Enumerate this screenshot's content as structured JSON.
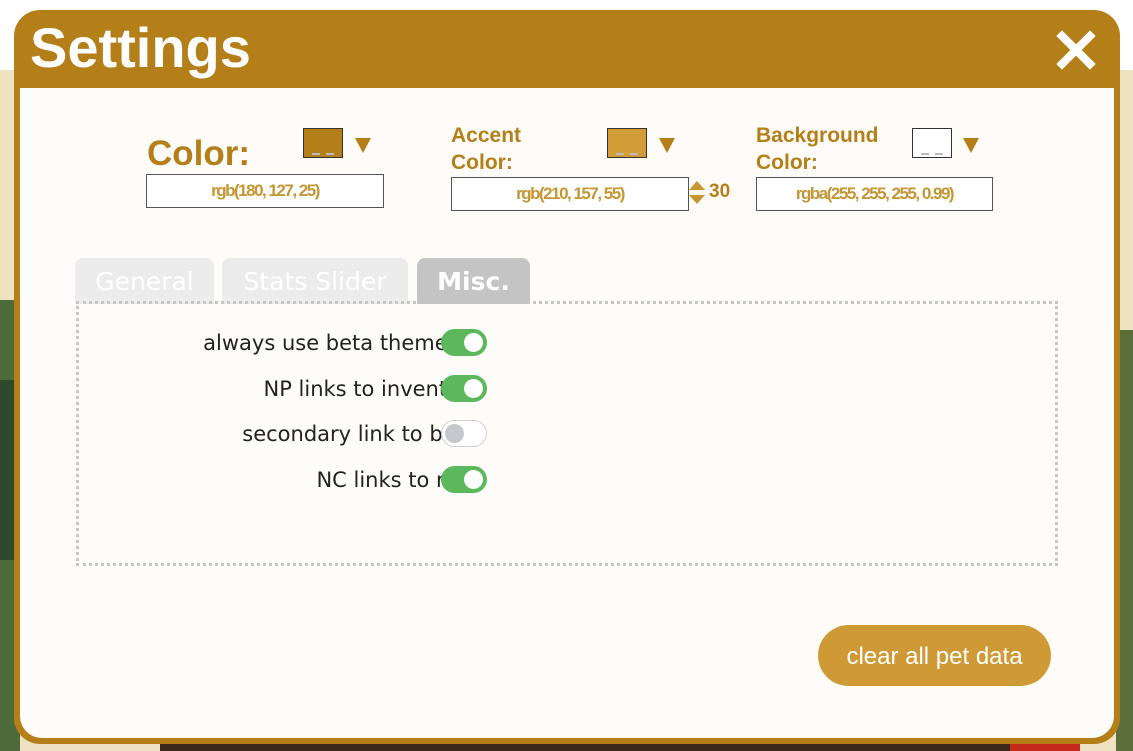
{
  "modal": {
    "title": "Settings",
    "close_icon": "close-icon"
  },
  "colors": {
    "primary": {
      "label": "Color:",
      "value": "rgb(180, 127, 25)",
      "swatch": "#b47f19"
    },
    "accent": {
      "label_line1": "Accent",
      "label_line2": "Color:",
      "value": "rgb(210, 157, 55)",
      "swatch": "#d29d37",
      "offset": "30"
    },
    "background": {
      "label_line1": "Background",
      "label_line2": "Color:",
      "value": "rgba(255, 255, 255, 0.99)",
      "swatch": "#ffffff"
    }
  },
  "tabs": [
    {
      "label": "General",
      "active": false
    },
    {
      "label": "Stats Slider",
      "active": false
    },
    {
      "label": "Misc.",
      "active": true
    }
  ],
  "options": [
    {
      "label": "always use beta theme bg",
      "enabled": true
    },
    {
      "label": "NP links to inventory",
      "enabled": true
    },
    {
      "label": "secondary link to bank",
      "enabled": false
    },
    {
      "label": "NC links to mall",
      "enabled": true
    }
  ],
  "actions": {
    "clear_label": "clear all pet data"
  }
}
